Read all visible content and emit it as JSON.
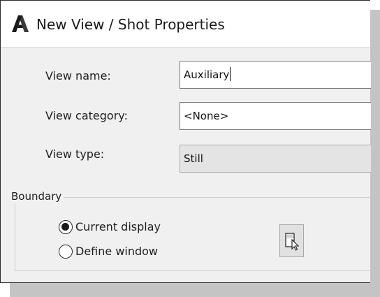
{
  "dialog": {
    "title": "New View / Shot Properties",
    "accent": "#1b1b1b"
  },
  "view_name": {
    "label": "View name:",
    "value": "Auxiliary"
  },
  "view_category": {
    "label": "View category:",
    "value": "<None>"
  },
  "view_type": {
    "label": "View type:",
    "value": "Still"
  },
  "boundary": {
    "label": "Boundary",
    "options": [
      {
        "label": "Current display",
        "selected": true
      },
      {
        "label": "Define window",
        "selected": false
      }
    ],
    "pick_button_icon": "define-window-cursor-icon"
  }
}
